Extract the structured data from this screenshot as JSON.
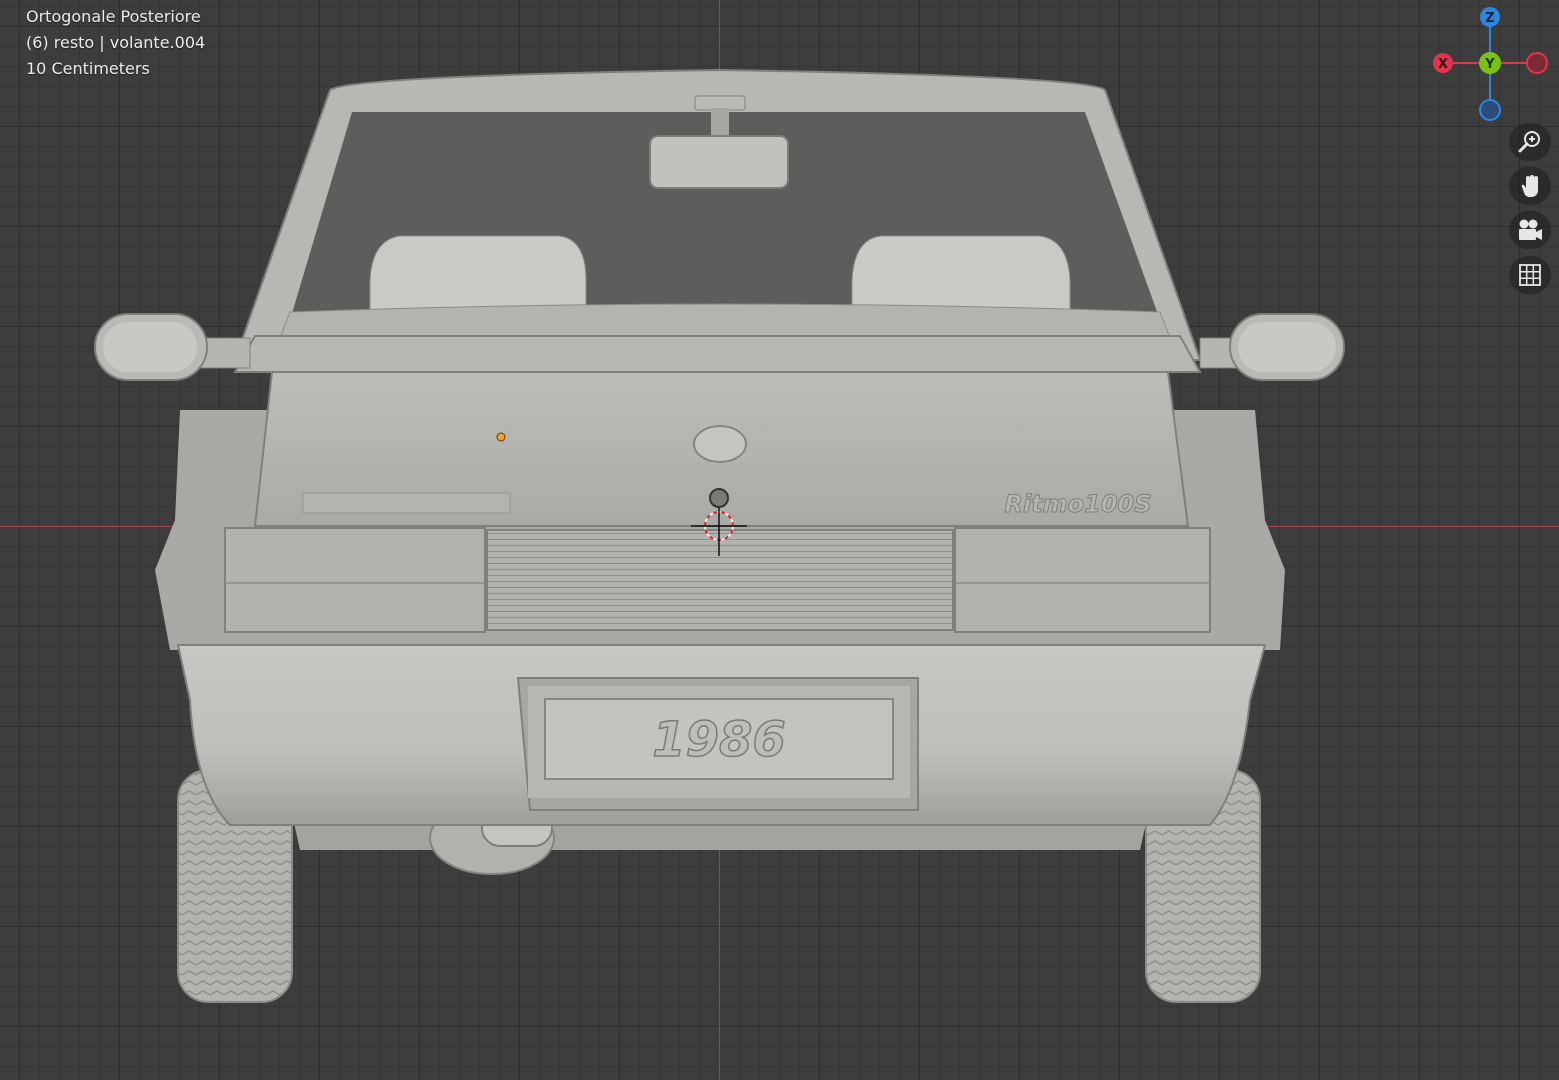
{
  "overlay": {
    "view_name": "Ortogonale Posteriore",
    "object_info": "(6) resto | volante.004",
    "grid_scale": "10 Centimeters"
  },
  "gizmo": {
    "z_label": "Z",
    "x_label": "X",
    "y_label": "Y",
    "colors": {
      "x": "#e0344f",
      "y": "#7ac316",
      "z": "#2e86de"
    }
  },
  "nav_buttons": [
    {
      "name": "zoom-icon"
    },
    {
      "name": "pan-hand-icon"
    },
    {
      "name": "camera-icon"
    },
    {
      "name": "grid-icon"
    }
  ],
  "car": {
    "badge": "Ritmo100S",
    "plate": "1986"
  }
}
